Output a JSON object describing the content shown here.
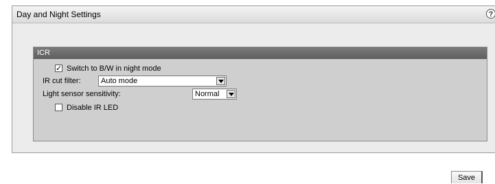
{
  "panel": {
    "title": "Day and Night Settings",
    "help_glyph": "?"
  },
  "icr": {
    "title": "ICR",
    "bw_switch": {
      "label": "Switch to B/W in night mode",
      "checked": true
    },
    "ir_cut": {
      "label": "IR cut filter:",
      "value": "Auto mode"
    },
    "sensor": {
      "label": "Light sensor sensitivity:",
      "value": "Normal"
    },
    "ir_led": {
      "label": "Disable IR LED",
      "checked": false
    }
  },
  "actions": {
    "save_label": "Save"
  },
  "icons": {
    "help": "help-icon",
    "dropdown": "chevron-down-icon",
    "checkbox": "checkbox"
  }
}
